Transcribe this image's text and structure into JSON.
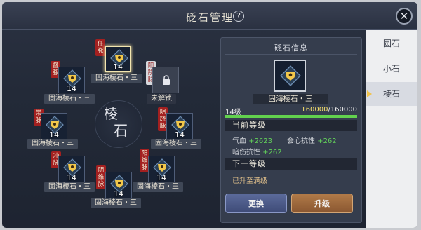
{
  "header": {
    "title": "砭石管理",
    "help_label": "?",
    "close_label": "✕"
  },
  "center_label": [
    "棱",
    "石"
  ],
  "slots": [
    {
      "id": "top",
      "meridian": "任脉",
      "level": "14",
      "name": "固海棱石・三",
      "selected": true,
      "locked": false
    },
    {
      "id": "upper-left",
      "meridian": "督脉",
      "level": "14",
      "name": "固海棱石・三",
      "selected": false,
      "locked": false
    },
    {
      "id": "upper-right",
      "meridian": "阳跷脉",
      "level": "",
      "name": "未解锁",
      "selected": false,
      "locked": true
    },
    {
      "id": "left",
      "meridian": "带脉",
      "level": "14",
      "name": "固海棱石・三",
      "selected": false,
      "locked": false
    },
    {
      "id": "right",
      "meridian": "阴跷脉",
      "level": "14",
      "name": "固海棱石・三",
      "selected": false,
      "locked": false
    },
    {
      "id": "lower-left",
      "meridian": "冲脉",
      "level": "14",
      "name": "固海棱石・三",
      "selected": false,
      "locked": false
    },
    {
      "id": "lower-right",
      "meridian": "阳维脉",
      "level": "14",
      "name": "固海棱石・三",
      "selected": false,
      "locked": false
    },
    {
      "id": "bottom",
      "meridian": "阴维脉",
      "level": "14",
      "name": "固海棱石・三",
      "selected": false,
      "locked": false
    }
  ],
  "info": {
    "title": "砭石信息",
    "gem_name": "固海棱石・三",
    "level_text": "14级",
    "progress_current": "160000",
    "progress_total": "/160000",
    "progress_fraction": 1.0,
    "current_level_heading": "当前等级",
    "stats": [
      {
        "label": "气血",
        "value": "+2623"
      },
      {
        "label": "会心抗性",
        "value": "+262"
      },
      {
        "label": "暗伤抗性",
        "value": "+262"
      }
    ],
    "next_level_heading": "下一等级",
    "next_level_text": "已升至满级",
    "replace_button": "更换",
    "upgrade_button": "升级"
  },
  "tabs": [
    {
      "label": "圆石",
      "active": false
    },
    {
      "label": "小石",
      "active": false
    },
    {
      "label": "棱石",
      "active": true
    }
  ],
  "colors": {
    "accent_green": "#62d14e",
    "tag_red": "#a32020",
    "gem_gold": "#f2c84b"
  }
}
